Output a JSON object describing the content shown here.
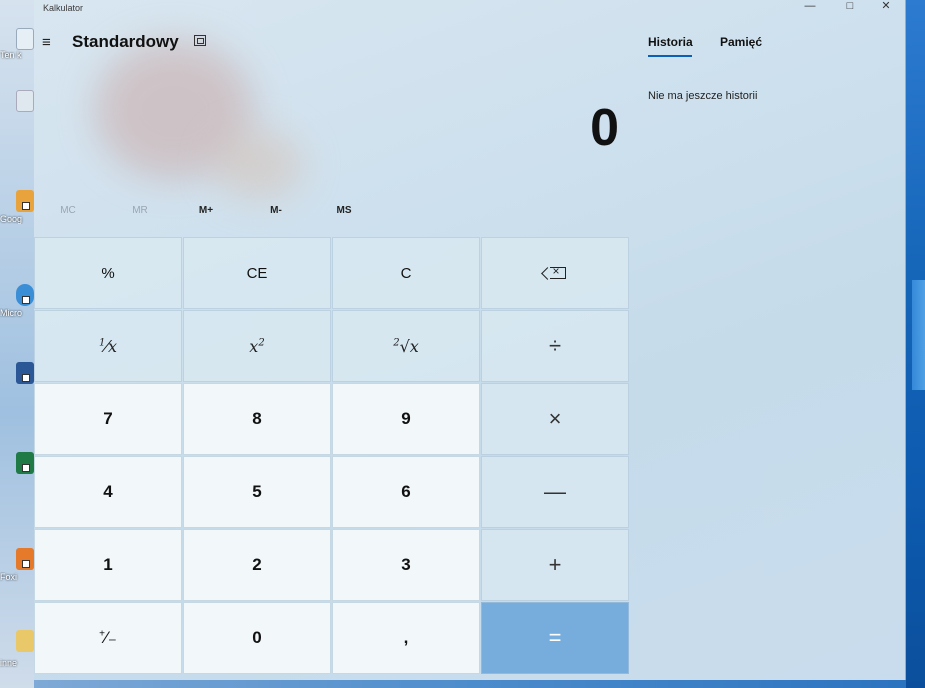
{
  "window": {
    "title": "Kalkulator",
    "controls": {
      "minimize": "—",
      "maximize": "□",
      "close": "✕"
    }
  },
  "header": {
    "menu_icon": "≡",
    "mode_title": "Standardowy",
    "keep_on_top_icon": "keep-on-top-icon"
  },
  "display": {
    "value": "0"
  },
  "memory": {
    "buttons": [
      "MC",
      "MR",
      "M+",
      "M-",
      "MS"
    ],
    "disabled": [
      "MC",
      "MR"
    ]
  },
  "keypad": {
    "row1": [
      "%",
      "CE",
      "C",
      "backspace"
    ],
    "row2": [
      "1/x",
      "x²",
      "²√x",
      "÷"
    ],
    "row3": [
      "7",
      "8",
      "9",
      "×"
    ],
    "row4": [
      "4",
      "5",
      "6",
      "—"
    ],
    "row5": [
      "1",
      "2",
      "3",
      "+"
    ],
    "row6": [
      "+/−",
      "0",
      ",",
      "="
    ],
    "labels": {
      "percent": "%",
      "ce": "CE",
      "c": "C",
      "divide": "÷",
      "multiply": "×",
      "minus": "—",
      "plus": "+",
      "equals": "=",
      "seven": "7",
      "eight": "8",
      "nine": "9",
      "four": "4",
      "five": "5",
      "six": "6",
      "one": "1",
      "two": "2",
      "three": "3",
      "zero": "0",
      "decimal": ","
    }
  },
  "history": {
    "tabs": [
      "Historia",
      "Pamięć"
    ],
    "active_tab": "Historia",
    "empty_text": "Nie ma jeszcze historii"
  },
  "desktop": {
    "icons": [
      "Ten k",
      "Goog",
      "Micro",
      "Foxi",
      "inne"
    ]
  },
  "colors": {
    "accent": "#0a5fb6",
    "equals_bg": "#76addc"
  }
}
